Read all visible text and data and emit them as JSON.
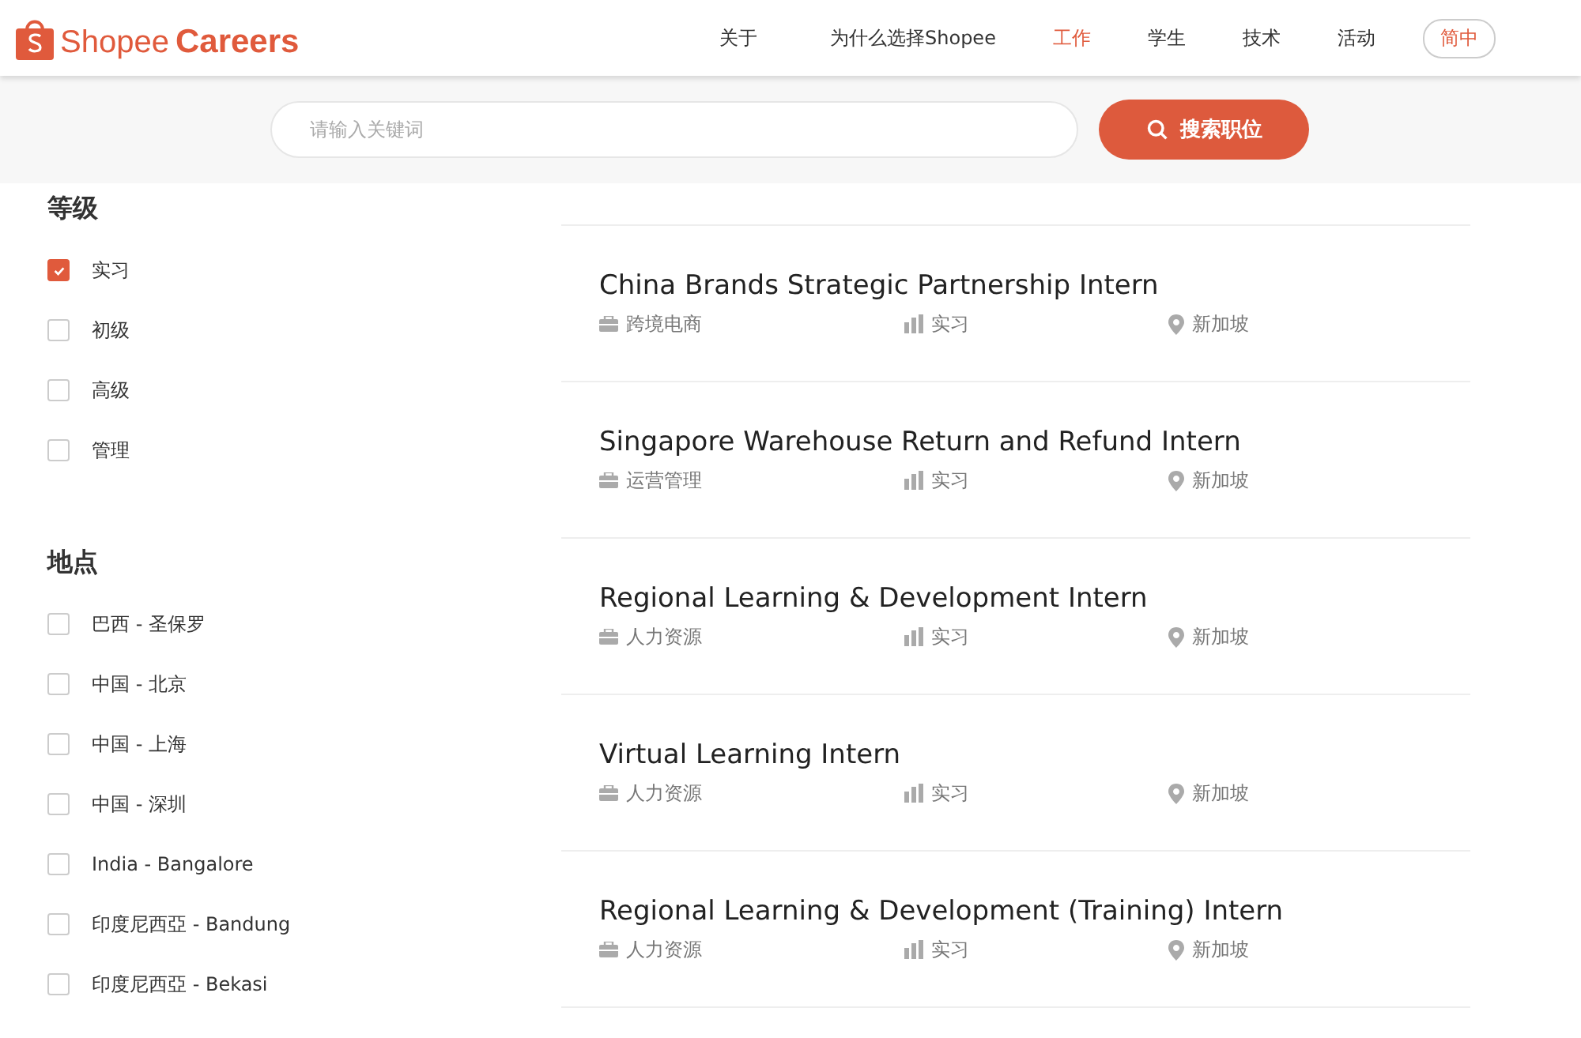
{
  "header": {
    "logo_text": "Shopee",
    "logo_suffix": "Careers",
    "nav": [
      {
        "label": "关于",
        "selected": false
      },
      {
        "label": "为什么选择Shopee",
        "selected": false
      },
      {
        "label": "工作",
        "selected": true
      },
      {
        "label": "学生",
        "selected": false
      },
      {
        "label": "技术",
        "selected": false
      },
      {
        "label": "活动",
        "selected": false
      }
    ],
    "language": "简中"
  },
  "search": {
    "placeholder": "请输入关键词",
    "button": "搜索职位"
  },
  "filters": [
    {
      "title": "等级",
      "options": [
        {
          "label": "实习",
          "checked": true
        },
        {
          "label": "初级",
          "checked": false
        },
        {
          "label": "高级",
          "checked": false
        },
        {
          "label": "管理",
          "checked": false
        }
      ]
    },
    {
      "title": "地点",
      "options": [
        {
          "label": "巴西 - 圣保罗",
          "checked": false
        },
        {
          "label": "中国 - 北京",
          "checked": false
        },
        {
          "label": "中国 - 上海",
          "checked": false
        },
        {
          "label": "中国 - 深圳",
          "checked": false
        },
        {
          "label": "India - Bangalore",
          "checked": false
        },
        {
          "label": "印度尼西亞 - Bandung",
          "checked": false
        },
        {
          "label": "印度尼西亞 - Bekasi",
          "checked": false
        }
      ]
    }
  ],
  "jobs": [
    {
      "title": "China Brands Strategic Partnership Intern",
      "department": "跨境电商",
      "level": "实习",
      "location": "新加坡"
    },
    {
      "title": "Singapore Warehouse Return and Refund Intern",
      "department": "运营管理",
      "level": "实习",
      "location": "新加坡"
    },
    {
      "title": "Regional Learning & Development Intern",
      "department": "人力资源",
      "level": "实习",
      "location": "新加坡"
    },
    {
      "title": "Virtual Learning Intern",
      "department": "人力资源",
      "level": "实习",
      "location": "新加坡"
    },
    {
      "title": "Regional Learning & Development (Training) Intern",
      "department": "人力资源",
      "level": "实习",
      "location": "新加坡"
    }
  ]
}
